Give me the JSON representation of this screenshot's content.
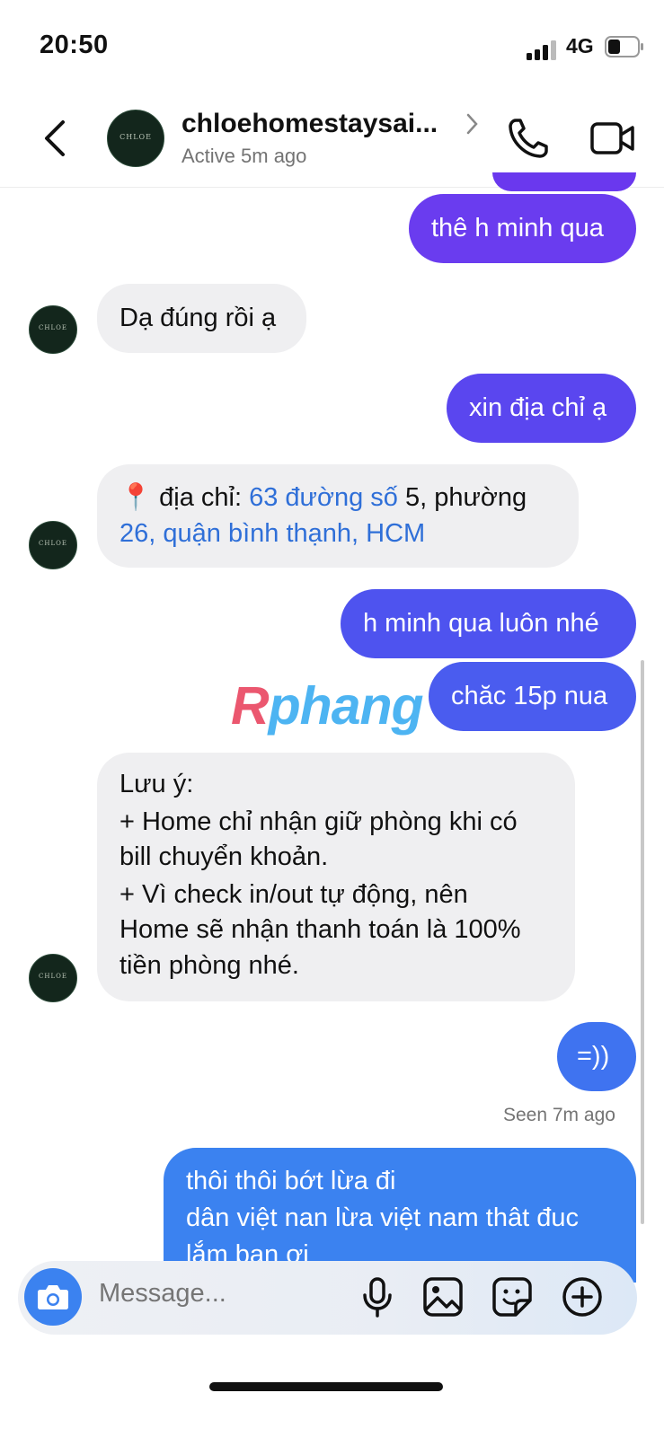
{
  "status_bar": {
    "time": "20:50",
    "network": "4G"
  },
  "header": {
    "name": "chloehomestaysai...",
    "status": "Active 5m ago",
    "avatar_text": "CHLOE"
  },
  "messages": [
    {
      "sender": "me",
      "text": "thê h minh qua",
      "color": "#6a3cef"
    },
    {
      "sender": "them",
      "text": "Dạ đúng rồi ạ"
    },
    {
      "sender": "me",
      "text": "xin địa chỉ ạ",
      "color": "#5a46ef"
    },
    {
      "sender": "them",
      "pin": "📍",
      "text_prefix": " địa chỉ: ",
      "link_1": "63 đường số",
      "text_mid": " 5, phường",
      "link_2": "26, quận bình thạnh, HCM"
    },
    {
      "sender": "me",
      "text": "h minh qua luôn nhé",
      "color": "#4e53ef"
    },
    {
      "sender": "me",
      "text": "chăc 15p nua",
      "color": "#4a5cef"
    },
    {
      "sender": "them",
      "lines": [
        "Lưu ý:",
        "+ Home chỉ nhận giữ phòng khi có",
        "bill chuyển khoản.",
        "+ Vì check in/out tự động, nên",
        "Home sẽ nhận thanh toán là 100%",
        "tiền phòng nhé."
      ]
    },
    {
      "sender": "me",
      "text": "=))",
      "color": "#3f73f0"
    },
    {
      "sender": "me",
      "lines": [
        "thôi thôi bớt lừa đi",
        "dân việt nan lừa việt nam thât đuc",
        "lắm bạn ơi"
      ],
      "color": "#3b82f0"
    }
  ],
  "seen": "Seen 7m ago",
  "watermark": {
    "first": "R",
    "rest": "phang"
  },
  "composer": {
    "placeholder": "Message..."
  },
  "icons": [
    "chevron-left-icon",
    "phone-icon",
    "video-icon",
    "camera-icon",
    "microphone-icon",
    "gallery-icon",
    "sticker-icon",
    "plus-circle-icon"
  ]
}
